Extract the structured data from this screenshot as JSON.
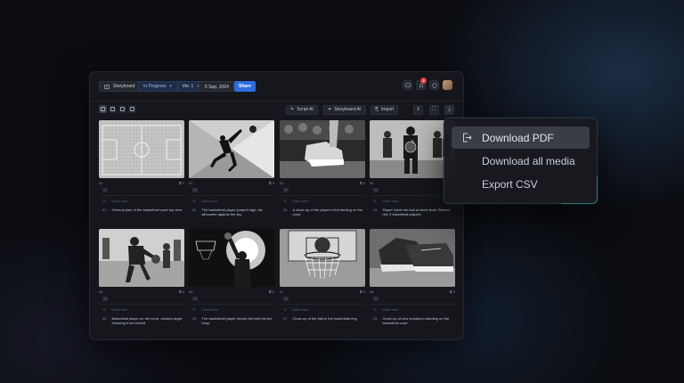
{
  "header": {
    "storyboard_label": "Storyboard",
    "status": "In Progress",
    "version": "Ver. 1",
    "date": "5 Sep, 2024",
    "share": "Share",
    "notification_count": "3"
  },
  "toolbar": {
    "script_ai": "Script AI",
    "storyboard_ai": "Storyboard AI",
    "import": "Import"
  },
  "frames": [
    {
      "num": "01",
      "count": "3",
      "hint": "Voice over",
      "desc_num": "01",
      "desc": "General plan of the basketball court top view"
    },
    {
      "num": "02",
      "count": "3",
      "hint": "Voice over",
      "desc_num": "02",
      "desc": "The basketball player jumped high, his silhouette against the sky"
    },
    {
      "num": "03",
      "count": "3",
      "hint": "Voice over",
      "desc_num": "03",
      "desc": "A close-up of the player's feet landing on the court"
    },
    {
      "num": "04",
      "count": "3",
      "hint": "Voice over",
      "desc_num": "04",
      "desc": "Player holds the ball at chest level. Behind him 3 basketball players."
    },
    {
      "num": "05",
      "count": "3",
      "hint": "Voice over",
      "desc_num": "05",
      "desc": "Basketball player on the court, camera angle following from behind"
    },
    {
      "num": "06",
      "count": "3",
      "hint": "Voice over",
      "desc_num": "06",
      "desc": "The basketball player throws the ball into the hoop"
    },
    {
      "num": "07",
      "count": "3",
      "hint": "Voice over",
      "desc_num": "07",
      "desc": "Close-up of the ball in the basketball ring"
    },
    {
      "num": "08",
      "count": "3",
      "hint": "Voice over",
      "desc_num": "08",
      "desc": "Close-up of new sneakers standing on the basketball court"
    }
  ],
  "dropdown": {
    "items": [
      "Download PDF",
      "Download all media",
      "Export CSV"
    ],
    "active_index": 0
  },
  "colors": {
    "accent": "#2f6bde",
    "status_bg": "#1f2c46",
    "badge": "#e53e3e"
  }
}
